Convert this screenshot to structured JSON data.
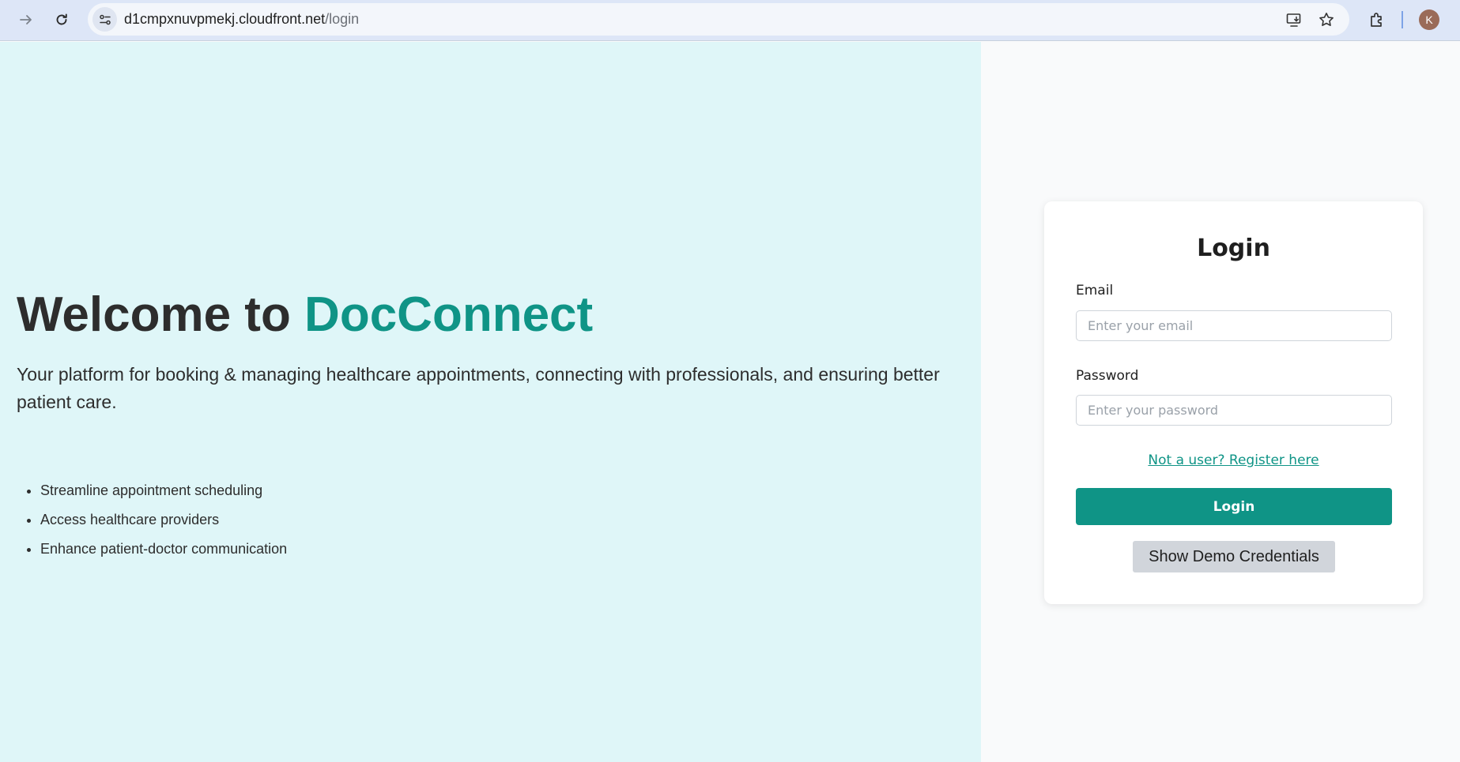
{
  "browser": {
    "url_host": "d1cmpxnuvpmekj.cloudfront.net",
    "url_path": "/login",
    "avatar_initial": "K",
    "icons": [
      "forward-icon",
      "reload-icon",
      "site-info-icon",
      "install-app-icon",
      "bookmark-star-icon",
      "extensions-icon"
    ]
  },
  "hero": {
    "title_prefix": "Welcome to ",
    "title_brand": "DocConnect",
    "description": "Your platform for booking & managing healthcare appointments, connecting with professionals, and ensuring better patient care.",
    "features": [
      "Streamline appointment scheduling",
      "Access healthcare providers",
      "Enhance patient-doctor communication"
    ]
  },
  "login": {
    "title": "Login",
    "email_label": "Email",
    "email_placeholder": "Enter your email",
    "email_value": "",
    "password_label": "Password",
    "password_placeholder": "Enter your password",
    "password_value": "",
    "register_link": "Not a user? Register here",
    "login_button": "Login",
    "demo_button": "Show Demo Credentials"
  },
  "colors": {
    "brand": "#0f9486",
    "hero_bg": "#dff6f8",
    "page_bg": "#f9fafb",
    "demo_button_bg": "#d1d5db"
  }
}
